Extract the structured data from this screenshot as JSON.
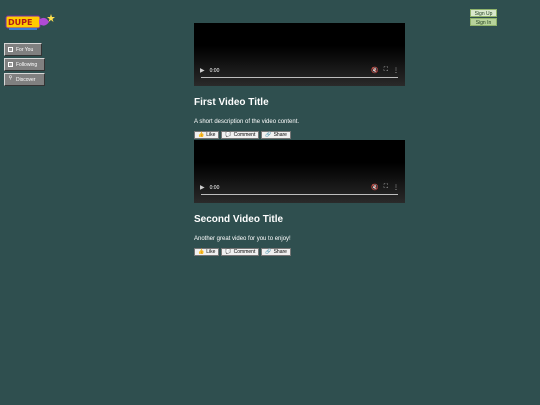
{
  "brand": {
    "logo_text": "DUPE"
  },
  "nav": [
    {
      "label": "For You",
      "icon": "home-icon"
    },
    {
      "label": "Following",
      "icon": "people-icon"
    },
    {
      "label": "Discover",
      "icon": "search-icon"
    }
  ],
  "auth": {
    "signup": "Sign Up",
    "signin": "Sign In"
  },
  "posts": [
    {
      "title": "First Video Title",
      "description": "A short description of the video content.",
      "time": "0:00",
      "actions": {
        "like": "Like",
        "comment": "Comment",
        "share": "Share"
      }
    },
    {
      "title": "Second Video Title",
      "description": "Another great video for you to enjoy!",
      "time": "0:00",
      "actions": {
        "like": "Like",
        "comment": "Comment",
        "share": "Share"
      }
    }
  ],
  "colors": {
    "background": "#2f4f4f",
    "nav_bg": "#808080",
    "auth_bg": "#d9e8cc"
  }
}
